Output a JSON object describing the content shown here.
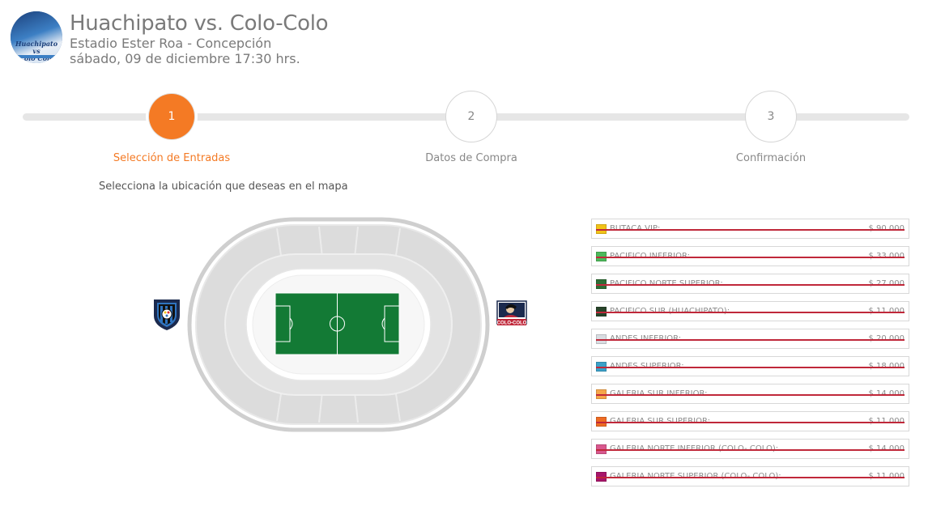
{
  "event": {
    "image_text_line1": "Huachipato vs",
    "image_text_line2": "Colo Colo",
    "title": "Huachipato vs. Colo-Colo",
    "venue": "Estadio Ester Roa - Concepción",
    "datetime": "sábado, 09 de diciembre 17:30 hrs."
  },
  "stepper": {
    "active_step": 1,
    "steps": [
      {
        "number": "1",
        "label": "Selección de Entradas"
      },
      {
        "number": "2",
        "label": "Datos de Compra"
      },
      {
        "number": "3",
        "label": "Confirmación"
      }
    ]
  },
  "instructions": "Selecciona la ubicación que deseas en el mapa",
  "teams": {
    "home_badge_icon": "huachipato-crest-icon",
    "away_badge_icon": "colo-colo-crest-icon",
    "away_badge_text": "COLO-COLO"
  },
  "legend": {
    "items": [
      {
        "name": "BUTACA VIP:",
        "price": "$ 90.000",
        "color": "#f2c318",
        "sold_out": true
      },
      {
        "name": "PACIFICO INFERIOR:",
        "price": "$ 33.000",
        "color": "#4cb85a",
        "sold_out": true
      },
      {
        "name": "PACIFICO NORTE SUPERIOR:",
        "price": "$ 27.000",
        "color": "#2f6e35",
        "sold_out": true
      },
      {
        "name": "PACIFICO SUR (HUACHIPATO):",
        "price": "$ 11.000",
        "color": "#28442a",
        "sold_out": true
      },
      {
        "name": "ANDES INFERIOR:",
        "price": "$ 20.000",
        "color": "#d9dde2",
        "sold_out": true
      },
      {
        "name": "ANDES SUPERIOR:",
        "price": "$ 18.000",
        "color": "#3ba0c8",
        "sold_out": true
      },
      {
        "name": "GALERIA SUR INFERIOR:",
        "price": "$ 14.000",
        "color": "#f6a64a",
        "sold_out": true
      },
      {
        "name": "GALERIA SUR SUPERIOR:",
        "price": "$ 11.000",
        "color": "#ee6b23",
        "sold_out": true
      },
      {
        "name": "GALERIA NORTE INFERIOR (COLO- COLO):",
        "price": "$ 14.000",
        "color": "#d9588e",
        "sold_out": true
      },
      {
        "name": "GALERIA NORTE SUPERIOR (COLO- COLO):",
        "price": "$ 11.000",
        "color": "#a8156a",
        "sold_out": true
      }
    ]
  }
}
